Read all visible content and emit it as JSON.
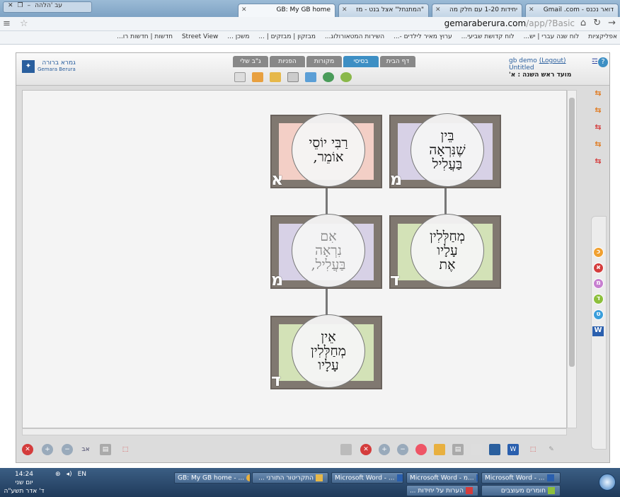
{
  "browser": {
    "window_tab_label": "עב 'הלהה",
    "tabs": [
      {
        "label": "GB: My GB home",
        "active": true
      },
      {
        "label": "\"המתנחל\" אצל בנט - מז",
        "active": false
      },
      {
        "label": "יחידות 1-20 עם חלק מה",
        "active": false
      },
      {
        "label": "דואר נכנס - Gmail .com",
        "active": false
      }
    ],
    "address": {
      "domain": "gemaraberura.com",
      "path": "/app/?Basic"
    },
    "bookmarks": [
      "אפליקציות",
      "לוח שנה עברי | יש...",
      "לוח קדושת שביעי...",
      "ערוץ מאיר לילדים -...",
      "השירות המטאורולוג...",
      "מבזקון | מבזקים | ...",
      "משכן ...",
      "Street View",
      "חדשות | חדשות רו..."
    ]
  },
  "app": {
    "logo_text": "גמרא ברורה",
    "logo_sub": "Gemara Berura",
    "tabs": [
      "דף הבית",
      "בסיסי",
      "מקורות",
      "הפניות",
      "ג\"ב שלי"
    ],
    "active_tab": "בסיסי",
    "user": {
      "name": "gb demo",
      "logout": "(Logout)",
      "doc": "Untitled",
      "session": "מועד ראש השנה : א'"
    }
  },
  "cards": [
    {
      "id": "card-bein",
      "text": "בֵּין\nשֶׁנִּרְאָה\nבַּעֲלִיל",
      "letter": "מ",
      "color": "#d7d1e6",
      "faint": false
    },
    {
      "id": "card-rabbi-yosi",
      "text": "רַבִּי יוֹסֵי\nאוֹמֵר,",
      "letter": "א",
      "color": "#f3cfc6",
      "faint": false
    },
    {
      "id": "card-mechalelin",
      "text": "מְחַלְּלִין\nעָלָיו\nאֶת",
      "letter": "ד",
      "color": "#d3e2b7",
      "faint": false
    },
    {
      "id": "card-im",
      "text": "אִם\nנִרְאָה\nבַּעֲלִיל,",
      "letter": "מ",
      "color": "#d7d1e6",
      "faint": true
    },
    {
      "id": "card-ein",
      "text": "אֵין\nמְחַלְּלִין\nעָלָיו",
      "letter": "ד",
      "color": "#d3e2b7",
      "faint": false
    }
  ],
  "sidebar_circles": [
    {
      "label": "כ",
      "color": "#f0a030"
    },
    {
      "label": "א",
      "color": "#d43c3c"
    },
    {
      "label": "מ",
      "color": "#c77fd0"
    },
    {
      "label": "ד",
      "color": "#8cbf3c"
    },
    {
      "label": "ט",
      "color": "#3a9edb"
    }
  ],
  "taskbar": {
    "time": "14:24",
    "day": "יום שני",
    "date": "ד' אדר תשע\"ה",
    "lang": "EN",
    "buttons": [
      "GB: My GB home - ...",
      "התקריטור התורני ...",
      "Microsoft Word - ...",
      "Microsoft Word - מ...",
      "Microsoft Word - ...",
      "הערות על יחידות ...",
      "חומרים מעוצבים"
    ]
  }
}
